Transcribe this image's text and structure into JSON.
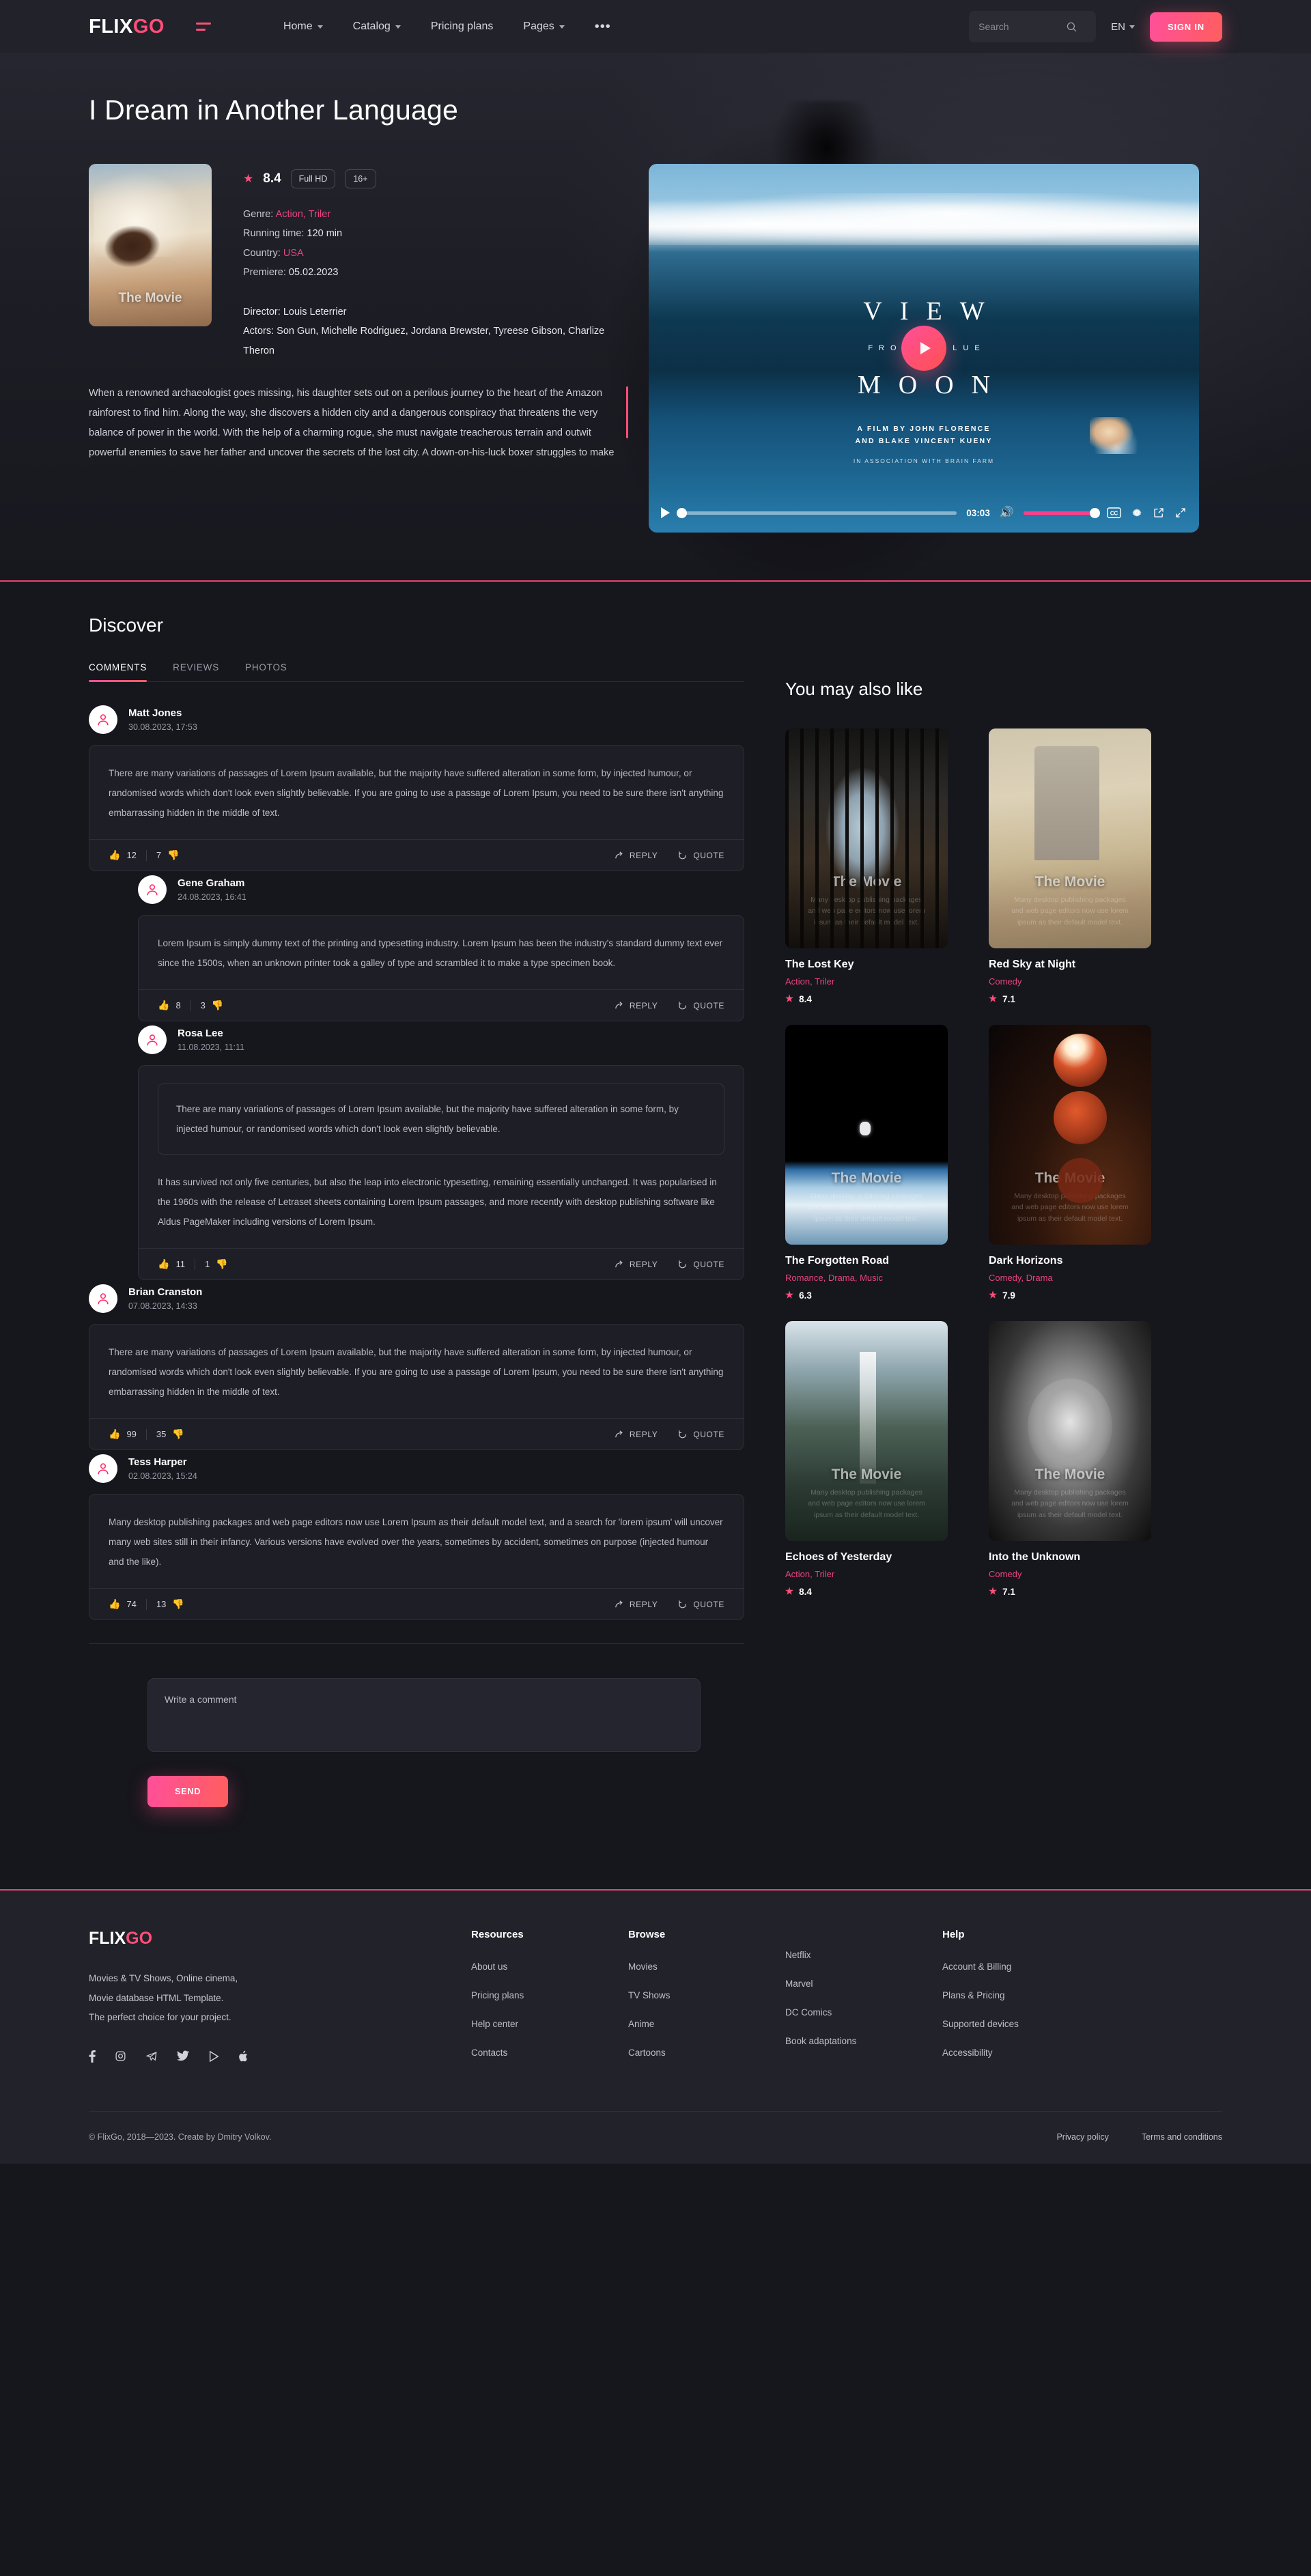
{
  "header": {
    "logo_flix": "FLIX",
    "logo_go": "GO",
    "nav": [
      {
        "label": "Home",
        "has_caret": true
      },
      {
        "label": "Catalog",
        "has_caret": true
      },
      {
        "label": "Pricing plans",
        "has_caret": false
      },
      {
        "label": "Pages",
        "has_caret": true
      }
    ],
    "more": "•••",
    "search_placeholder": "Search",
    "search_value": "",
    "lang": "EN",
    "signin": "SIGN IN"
  },
  "hero": {
    "title": "I Dream in Another Language",
    "poster_label": "The Movie",
    "rating": "8.4",
    "quality": "Full HD",
    "age": "16+",
    "meta": [
      {
        "key": "Genre:",
        "value": "Action, Triler",
        "pink": true
      },
      {
        "key": "Running time:",
        "value": "120 min",
        "pink": false
      },
      {
        "key": "Country:",
        "value": "USA",
        "pink": true
      },
      {
        "key": "Premiere:",
        "value": "05.02.2023",
        "pink": false
      }
    ],
    "credits": [
      {
        "key": "Director:",
        "value": "Louis Leterrier",
        "pink": true
      },
      {
        "key": "Actors:",
        "value": "Son Gun, Michelle Rodriguez, Jordana Brewster, Tyreese Gibson, Charlize Theron",
        "pink": true
      }
    ],
    "synopsis": "When a renowned archaeologist goes missing, his daughter sets out on a perilous journey to the heart of the Amazon rainforest to find him. Along the way, she discovers a hidden city and a dangerous conspiracy that threatens the very balance of power in the world. With the help of a charming rogue, she must navigate treacherous terrain and outwit powerful enemies to save her father and uncover the secrets of the lost city. A down-on-his-luck boxer struggles to make"
  },
  "player": {
    "title_top": "VIEW",
    "title_mid": "FROM A BLUE",
    "title_bottom": "MOON",
    "credit_line1": "A FILM BY JOHN FLORENCE",
    "credit_line2": "AND BLAKE VINCENT KUENY",
    "credit_line3": "IN ASSOCIATION WITH BRAIN FARM",
    "time": "03:03",
    "cc_label": "CC"
  },
  "discover": {
    "title": "Discover",
    "tabs": [
      {
        "label": "COMMENTS",
        "active": true
      },
      {
        "label": "REVIEWS",
        "active": false
      },
      {
        "label": "PHOTOS",
        "active": false
      }
    ],
    "comments": [
      {
        "name": "Matt Jones",
        "date": "30.08.2023, 17:53",
        "nested": false,
        "quote": null,
        "text": "There are many variations of passages of Lorem Ipsum available, but the majority have suffered alteration in some form, by injected humour, or randomised words which don't look even slightly believable. If you are going to use a passage of Lorem Ipsum, you need to be sure there isn't anything embarrassing hidden in the middle of text.",
        "up": "12",
        "down": "7",
        "reply": "REPLY",
        "quote_label": "QUOTE"
      },
      {
        "name": "Gene Graham",
        "date": "24.08.2023, 16:41",
        "nested": true,
        "quote": null,
        "text": "Lorem Ipsum is simply dummy text of the printing and typesetting industry. Lorem Ipsum has been the industry's standard dummy text ever since the 1500s, when an unknown printer took a galley of type and scrambled it to make a type specimen book.",
        "up": "8",
        "down": "3",
        "reply": "REPLY",
        "quote_label": "QUOTE"
      },
      {
        "name": "Rosa Lee",
        "date": "11.08.2023, 11:11",
        "nested": true,
        "quote": "There are many variations of passages of Lorem Ipsum available, but the majority have suffered alteration in some form, by injected humour, or randomised words which don't look even slightly believable.",
        "text": "It has survived not only five centuries, but also the leap into electronic typesetting, remaining essentially unchanged. It was popularised in the 1960s with the release of Letraset sheets containing Lorem Ipsum passages, and more recently with desktop publishing software like Aldus PageMaker including versions of Lorem Ipsum.",
        "up": "11",
        "down": "1",
        "reply": "REPLY",
        "quote_label": "QUOTE"
      },
      {
        "name": "Brian Cranston",
        "date": "07.08.2023, 14:33",
        "nested": false,
        "quote": null,
        "text": "There are many variations of passages of Lorem Ipsum available, but the majority have suffered alteration in some form, by injected humour, or randomised words which don't look even slightly believable. If you are going to use a passage of Lorem Ipsum, you need to be sure there isn't anything embarrassing hidden in the middle of text.",
        "up": "99",
        "down": "35",
        "reply": "REPLY",
        "quote_label": "QUOTE"
      },
      {
        "name": "Tess Harper",
        "date": "02.08.2023, 15:24",
        "nested": false,
        "quote": null,
        "text": "Many desktop publishing packages and web page editors now use Lorem Ipsum as their default model text, and a search for 'lorem ipsum' will uncover many web sites still in their infancy. Various versions have evolved over the years, sometimes by accident, sometimes on purpose (injected humour and the like).",
        "up": "74",
        "down": "13",
        "reply": "REPLY",
        "quote_label": "QUOTE"
      }
    ],
    "form": {
      "placeholder": "Write a comment",
      "value": "",
      "send_label": "SEND"
    }
  },
  "sidebar": {
    "title": "You may also like",
    "thumb_label": "The Movie",
    "thumb_desc": "Many desktop publishing packages and web page editors now use lorem ipsum as their default model text.",
    "cards": [
      {
        "name": "The Lost Key",
        "genre": "Action, Triler",
        "rating": "8.4",
        "theme": "th-forest"
      },
      {
        "name": "Red Sky at Night",
        "genre": "Comedy",
        "rating": "7.1",
        "theme": "th-castle"
      },
      {
        "name": "The Forgotten Road",
        "genre": "Romance, Drama, Music",
        "rating": "6.3",
        "theme": "th-space"
      },
      {
        "name": "Dark Horizons",
        "genre": "Comedy, Drama",
        "rating": "7.9",
        "theme": "th-mars"
      },
      {
        "name": "Echoes of Yesterday",
        "genre": "Action, Triler",
        "rating": "8.4",
        "theme": "th-falls"
      },
      {
        "name": "Into the Unknown",
        "genre": "Comedy",
        "rating": "7.1",
        "theme": "th-lion"
      }
    ]
  },
  "footer": {
    "logo_flix": "FLIX",
    "logo_go": "GO",
    "desc_line1": "Movies & TV Shows, Online cinema,",
    "desc_line2": "Movie database HTML Template.",
    "desc_line3": "The perfect choice for your project.",
    "socials": [
      "facebook-icon",
      "instagram-icon",
      "telegram-icon",
      "twitter-icon",
      "vimeo-icon",
      "apple-icon"
    ],
    "columns": [
      {
        "head": "Resources",
        "items": [
          "About us",
          "Pricing plans",
          "Help center",
          "Contacts"
        ]
      },
      {
        "head": "Browse",
        "items": [
          "Movies",
          "TV Shows",
          "Anime",
          "Cartoons"
        ]
      },
      {
        "head": "",
        "items": [
          "Netflix",
          "Marvel",
          "DC Comics",
          "Book adaptations"
        ]
      },
      {
        "head": "Help",
        "items": [
          "Account & Billing",
          "Plans & Pricing",
          "Supported devices",
          "Accessibility"
        ]
      }
    ],
    "copyright": "© FlixGo, 2018—2023. Create by Dmitry Volkov.",
    "legal": [
      "Privacy policy",
      "Terms and conditions"
    ]
  },
  "colors": {
    "accent_pink": "#ff4f78",
    "accent_magenta": "#e8437f",
    "bg_dark": "#16161d",
    "panel": "#22222a",
    "up_green": "#4caf6d",
    "down_red": "#e0414f"
  }
}
